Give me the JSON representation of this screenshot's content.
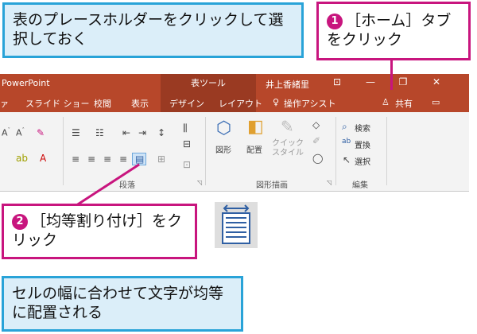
{
  "callouts": {
    "c1": "表のプレースホルダーをクリックして選択しておく",
    "c2_num": "❶",
    "c2": "［ホーム］タブをクリック",
    "c3_num": "❷",
    "c3": "［均等割り付け］をクリック",
    "c4": "セルの幅に合わせて文字が均等に配置される"
  },
  "titlebar": {
    "app": "PowerPoint",
    "context": "表ツール",
    "user": "井上香緒里",
    "controls": [
      "⊡",
      "—",
      "❐",
      "✕"
    ]
  },
  "tabs": [
    "ァ",
    "スライド ショー",
    "校閲",
    "表示",
    "デザイン",
    "レイアウト",
    "操作アシスト"
  ],
  "share": "共有",
  "ribbon": {
    "groups": [
      "段落",
      "図形描画",
      "編集"
    ],
    "shape_label": "図形",
    "arrange_label": "配置",
    "quickstyle_label": "クイック\nスタイル",
    "find": "検索",
    "replace": "置換",
    "select": "選択"
  }
}
